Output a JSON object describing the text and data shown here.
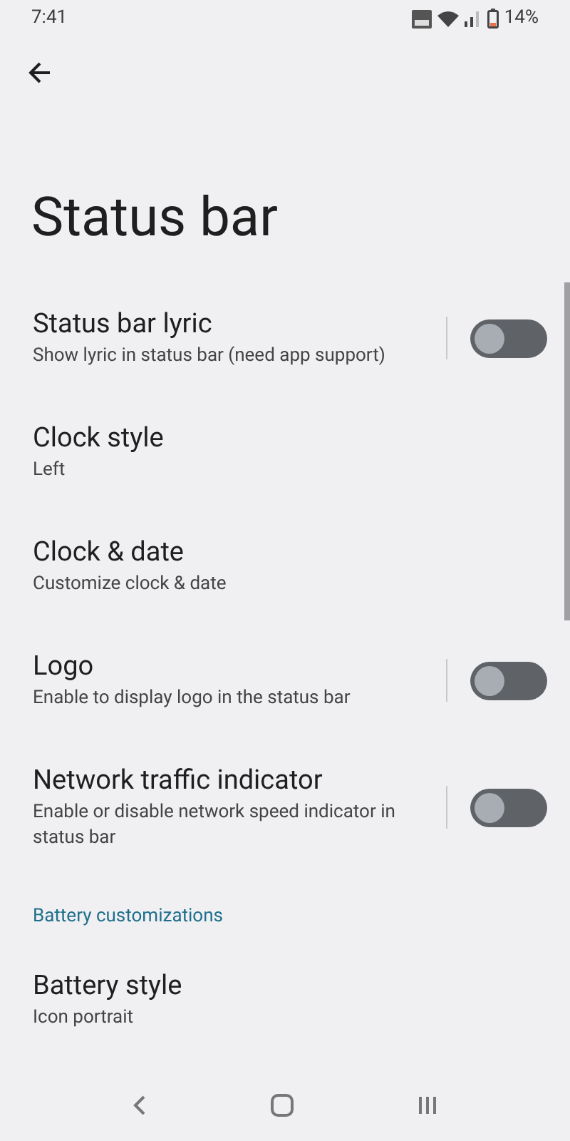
{
  "status_bar": {
    "time": "7:41",
    "battery": "14%"
  },
  "title": "Status bar",
  "items": [
    {
      "kind": "toggle",
      "title": "Status bar lyric",
      "subtitle": "Show lyric in status bar (need app support)",
      "on": false
    },
    {
      "kind": "link",
      "title": "Clock style",
      "subtitle": "Left"
    },
    {
      "kind": "link",
      "title": "Clock & date",
      "subtitle": "Customize clock & date"
    },
    {
      "kind": "toggle",
      "title": "Logo",
      "subtitle": "Enable to display logo in the status bar",
      "on": false
    },
    {
      "kind": "toggle",
      "title": "Network traffic indicator",
      "subtitle": "Enable or disable network speed indicator in status bar",
      "on": false
    },
    {
      "kind": "header",
      "title": "Battery customizations"
    },
    {
      "kind": "link",
      "title": "Battery style",
      "subtitle": "Icon portrait"
    }
  ]
}
